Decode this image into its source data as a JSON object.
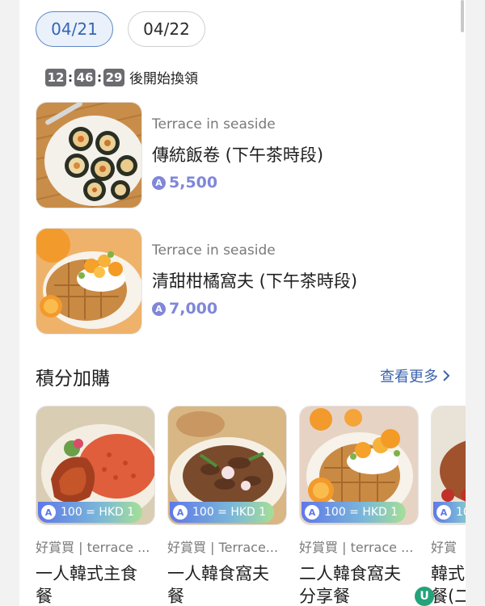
{
  "date_tabs": [
    {
      "label": "04/21",
      "active": true
    },
    {
      "label": "04/22",
      "active": false
    }
  ],
  "countdown": {
    "hours": "12",
    "minutes": "46",
    "seconds": "29",
    "suffix": "後開始換領"
  },
  "offers": [
    {
      "store": "Terrace in seaside",
      "title": "傳統飯卷 (下午茶時段)",
      "points": "5,500",
      "image": "kimbap-photo"
    },
    {
      "store": "Terrace in seaside",
      "title": "清甜柑橘窩夫 (下午茶時段)",
      "points": "7,000",
      "image": "orange-waffle-photo"
    }
  ],
  "section": {
    "title": "積分加購",
    "more_label": "查看更多"
  },
  "products": [
    {
      "badge": "100 = HKD 1",
      "store": "好賞買 | terrace ...",
      "name_line1": "一人韓式主食",
      "name_line2": "餐",
      "image": "chicken-rice-photo"
    },
    {
      "badge": "100 = HKD 1",
      "store": "好賞買 | Terrace...",
      "name_line1": "一人韓食窩夫",
      "name_line2": "餐",
      "image": "bulgogi-photo"
    },
    {
      "badge": "100 = HKD 1",
      "store": "好賞買 | terrace ...",
      "name_line1": "二人韓食窩夫",
      "name_line2": "分享餐",
      "image": "orange-waffle-photo"
    },
    {
      "badge": "10",
      "store": "好賞",
      "name_line1": "韓式",
      "name_line2": "餐(二",
      "image": "partial-food-photo"
    }
  ],
  "point_icon_glyph": "A",
  "fab_glyph": "U",
  "colors": {
    "accent": "#3565b0",
    "points": "#7f87d8",
    "link": "#3b63ad"
  }
}
